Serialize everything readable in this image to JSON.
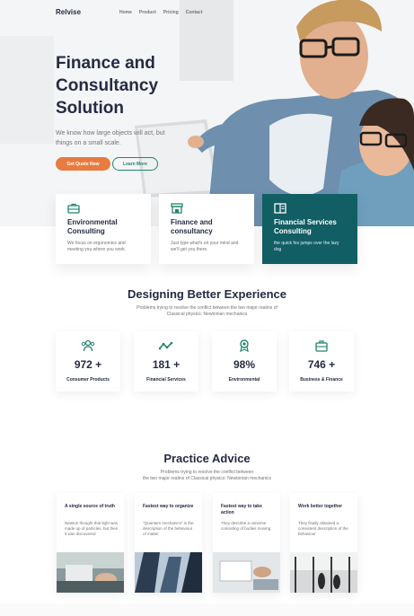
{
  "brand": "Relvise",
  "nav": [
    "Home",
    "Product",
    "Pricing",
    "Contact"
  ],
  "hero": {
    "title": "Finance and Consultancy Solution",
    "text": "We know how large objects will act, but things on a small scale.",
    "primary_button": "Get Quote Now",
    "secondary_button": "Learn More"
  },
  "services": [
    {
      "title": "Environmental Consulting",
      "desc": "We focus on ergonomics and meeting you where you work.",
      "icon": "briefcase-icon"
    },
    {
      "title": "Finance and consultancy",
      "desc": "Just type what's on your mind and we'll get you there.",
      "icon": "store-icon"
    },
    {
      "title": "Financial Services Consulting",
      "desc": "the quick fox jumps over the lazy dog",
      "icon": "book-icon"
    }
  ],
  "experience": {
    "title": "Designing Better Experience",
    "subtitle": "Problems trying to resolve the conflict between the two major realms of Classical physics: Newtonian mechanics",
    "stats": [
      {
        "value": "972 +",
        "label": "Consumer Products",
        "icon": "users-icon"
      },
      {
        "value": "181 +",
        "label": "Financial Services",
        "icon": "trend-icon"
      },
      {
        "value": "98%",
        "label": "Environmental",
        "icon": "award-icon"
      },
      {
        "value": "746 +",
        "label": "Business & Finance",
        "icon": "briefcase-icon"
      }
    ]
  },
  "practice": {
    "title": "Practice Advice",
    "subtitle_line1": "Problems trying to resolve the conflict between",
    "subtitle_line2": "the two major realms of Classical physics: Newtonian mechanics",
    "cards": [
      {
        "title": "A single source of truth",
        "text": "Newton thought that light was made up of particles, but then it was discovered"
      },
      {
        "title": "Fastest way to organize",
        "text": "\"Quantum mechanics\" is the description of the behaviour of matter"
      },
      {
        "title": "Fastest way to take action",
        "text": "They describe a universe consisting of bodies moving"
      },
      {
        "title": "Work better together",
        "text": "They finally obtained a consistent description of the behaviour"
      }
    ]
  },
  "colors": {
    "accent_orange": "#e77c40",
    "accent_green": "#23856d",
    "dark_teal": "#115e64",
    "heading": "#252b42",
    "body_text": "#737373"
  }
}
